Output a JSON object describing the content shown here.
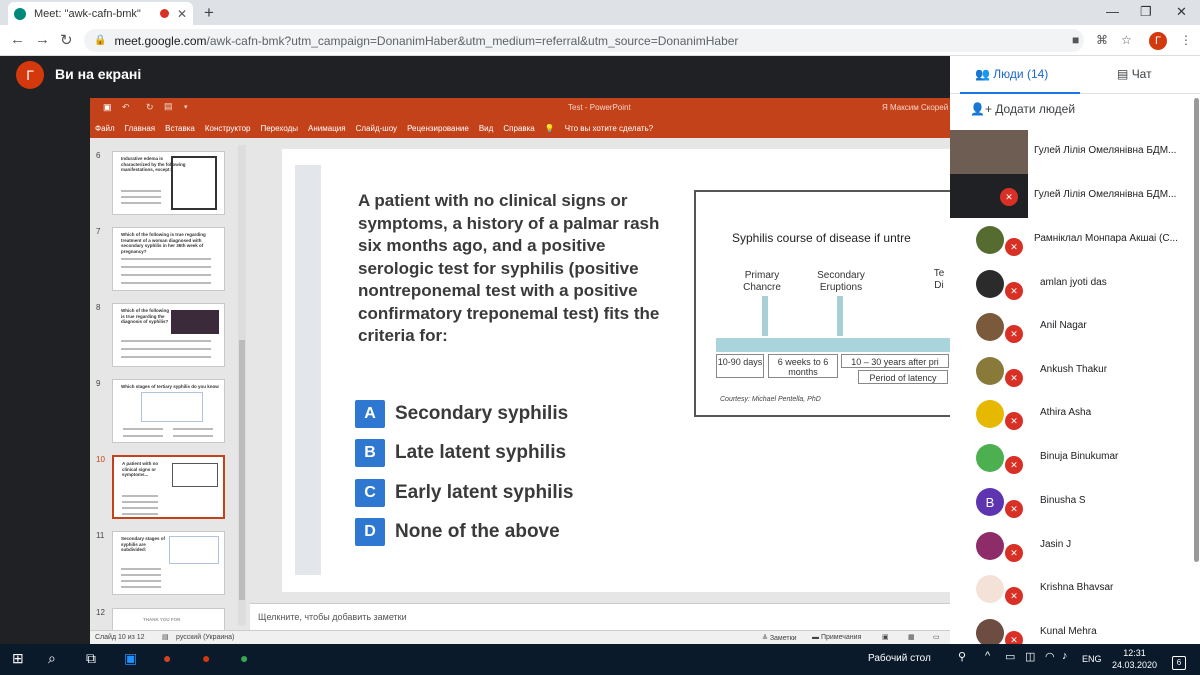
{
  "browser": {
    "tab_title": "Meet: \"awk-cafn-bmk\"",
    "new_tab": "+",
    "url_host": "meet.google.com",
    "url_path": "/awk-cafn-bmk?utm_campaign=DonanimHaber&utm_medium=referral&utm_source=DonanimHaber",
    "profile_initial": "Г"
  },
  "meet": {
    "avatar_initial": "Г",
    "presenting_label": "Ви на екрані",
    "people_tab": "Люди (14)",
    "chat_tab": "Чат",
    "add_people": "Додати людей",
    "participants": [
      {
        "name": "Гулей Лілія Омелянівна БДМ...",
        "avatar_color": "#6d5d52"
      },
      {
        "name": "Гулей Лілія Омелянівна БДМ...",
        "avatar_color": "#202124"
      },
      {
        "name": "Рамніклал Монпара Акшаі (С...",
        "avatar_color": "#556b2f"
      },
      {
        "name": "amlan jyoti das",
        "avatar_color": "#2b2b2b"
      },
      {
        "name": "Anil Nagar",
        "avatar_color": "#7a5a3a"
      },
      {
        "name": "Ankush Thakur",
        "avatar_color": "#8a7a3a"
      },
      {
        "name": "Athira Asha",
        "avatar_color": "#e6b800"
      },
      {
        "name": "Binuja Binukumar",
        "avatar_color": "#4caf50"
      },
      {
        "name": "Binusha S",
        "avatar_color": "#5e35b1",
        "initial": "B"
      },
      {
        "name": "Jasin J",
        "avatar_color": "#8e2c6a"
      },
      {
        "name": "Krishna Bhavsar",
        "avatar_color": "#f4e2d8"
      },
      {
        "name": "Kunal Mehra",
        "avatar_color": "#6d4c41"
      }
    ]
  },
  "powerpoint": {
    "title": "Test  -  PowerPoint",
    "user": "Я Максим Скорей",
    "menu": [
      "Файл",
      "Главная",
      "Вставка",
      "Конструктор",
      "Переходы",
      "Анимация",
      "Слайд-шоу",
      "Рецензирование",
      "Вид",
      "Справка",
      "Что вы хотите сделать?"
    ],
    "thumb_numbers": [
      "6",
      "7",
      "8",
      "9",
      "10",
      "11",
      "12"
    ],
    "thumb_titles": [
      "Indurative edema is characterized by the following manifestations, except:",
      "Which of the following is true regarding treatment of a woman diagnosed with secondary syphilis in her 36th week of pregnancy?",
      "Which of the following is true regarding the diagnosis of syphilis?",
      "Which stages of tertiary syphilis do you know",
      "A patient with no clinical signs or symptoms...",
      "Secondary stages of syphilis are subdivided:",
      "THANK YOU FOR"
    ],
    "question": "A patient with no clinical signs or symptoms, a history of a palmar rash six months ago, and a positive serologic test for syphilis (positive nontreponemal test with a positive confirmatory treponemal test) fits the criteria for:",
    "options": [
      {
        "letter": "A",
        "text": "Secondary syphilis"
      },
      {
        "letter": "B",
        "text": "Late latent syphilis"
      },
      {
        "letter": "C",
        "text": "Early latent syphilis"
      },
      {
        "letter": "D",
        "text": "None of the above"
      }
    ],
    "figure": {
      "title": "Syphilis course of disease if untre",
      "label_primary": "Primary Chancre",
      "label_secondary": "Secondary Eruptions",
      "label_te": "Te Di",
      "box1": "10-90 days",
      "box2": "6 weeks to 6 months",
      "box3": "10 – 30 years after pri",
      "box4": "Period of latency",
      "courtesy": "Courtesy: Michael Pentella, PhD"
    },
    "notes_placeholder": "Щелкните, чтобы добавить заметки",
    "status_slide": "Слайд 10 из 12",
    "status_lang": "русский (Украина)",
    "status_notes": "Заметки",
    "status_comments": "Примечания"
  },
  "taskbar": {
    "desktop_label": "Рабочий стол",
    "lang": "ENG",
    "time": "12:31",
    "date": "24.03.2020",
    "notif_count": "6"
  }
}
